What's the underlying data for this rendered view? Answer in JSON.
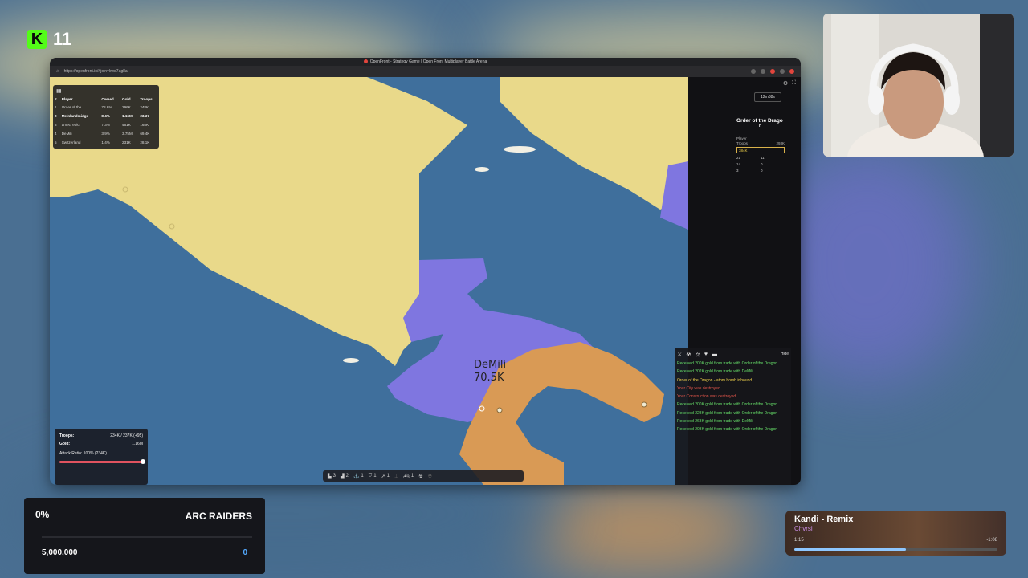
{
  "overlay": {
    "viewer_count": "11",
    "logo": "kick-logo"
  },
  "browser": {
    "window_title": "OpenFront - Strategy Game | Open Front Multiplayer Battle Arena",
    "url": "https://openfront.io/#join=kwq7ag8a"
  },
  "leaderboard": {
    "headers": [
      "#",
      "Player",
      "Owned",
      "Gold",
      "Troops"
    ],
    "rows": [
      {
        "rank": "1",
        "player": "Order of the ...",
        "owned": "78.6%",
        "gold": "296K",
        "troops": "248K"
      },
      {
        "rank": "2",
        "player": "Meinlandmidge",
        "owned": "8.4%",
        "gold": "1.16M",
        "troops": "234K",
        "me": true
      },
      {
        "rank": "3",
        "player": "ameci epic",
        "owned": "7.3%",
        "gold": "461K",
        "troops": "165K"
      },
      {
        "rank": "4",
        "player": "DeMili",
        "owned": "3.9%",
        "gold": "3.75M",
        "troops": "69.4K"
      },
      {
        "rank": "5",
        "player": "Switzerland",
        "owned": "1.4%",
        "gold": "231K",
        "troops": "28.1K"
      }
    ]
  },
  "map": {
    "player_label_name": "DeMili",
    "player_label_troops": "70.5K"
  },
  "troop_panel": {
    "troops_label": "Troops:",
    "troops_value": "234K / 237K (+95)",
    "gold_label": "Gold:",
    "gold_value": "1.16M",
    "attack_ratio": "Attack Ratio: 100% (234K)",
    "attack_ratio_fraction": 1.0
  },
  "build_bar": {
    "items": [
      {
        "icon": "city-icon",
        "count": "3"
      },
      {
        "icon": "factory-icon",
        "count": "2"
      },
      {
        "icon": "port-icon",
        "count": "1"
      },
      {
        "icon": "defense-icon",
        "count": "1"
      },
      {
        "icon": "missile-silo-icon",
        "count": "1"
      },
      {
        "icon": "sam-icon",
        "count": ""
      },
      {
        "icon": "warship-icon",
        "count": "1"
      },
      {
        "icon": "nuke-icon",
        "count": ""
      },
      {
        "icon": "hydrogen-icon",
        "count": ""
      }
    ]
  },
  "sidebar": {
    "timer": "12m38s",
    "player_name": "Order of the Drago",
    "player_name_cont": "n",
    "player_type": "Player",
    "troops_small": "Troops",
    "troops_small_value": "293K",
    "gold_box": "384K",
    "stats": [
      "21",
      "11",
      "14",
      "0",
      "3",
      "0"
    ]
  },
  "events": {
    "hide_label": "Hide",
    "messages": [
      {
        "text": "Received 200K gold from trade with Order of the Dragon",
        "type": "green"
      },
      {
        "text": "Received 202K gold from trade with DeMili",
        "type": "green"
      },
      {
        "text": "Order of the Dragon - atom bomb inbound",
        "type": "yellow"
      },
      {
        "text": "Your City was destroyed",
        "type": "red"
      },
      {
        "text": "Your Construction was destroyed",
        "type": "red"
      },
      {
        "text": "Received 200K gold from trade with Order of the Dragon",
        "type": "green"
      },
      {
        "text": "Received 228K gold from trade with Order of the Dragon",
        "type": "green"
      },
      {
        "text": "Received 263K gold from trade with DeMili",
        "type": "green"
      },
      {
        "text": "Received 203K gold from trade with Order of the Dragon",
        "type": "green"
      }
    ]
  },
  "stats_panel": {
    "percent": "0%",
    "game": "ARC RAIDERS",
    "target": "5,000,000",
    "current": "0"
  },
  "music": {
    "song": "Kandi - Remix",
    "artist": "Chvrsi",
    "elapsed": "1:15",
    "remaining": "-1:08",
    "progress_fraction": 0.55
  },
  "colors": {
    "ocean": "#3f6f9c",
    "player_yellow": "#e9d98a",
    "player_purple": "#7f76e0",
    "player_orange": "#d99a55",
    "event_green": "#67e06a",
    "event_yellow": "#f0d24b",
    "event_red": "#e5564b",
    "kick_green": "#53fc18"
  }
}
